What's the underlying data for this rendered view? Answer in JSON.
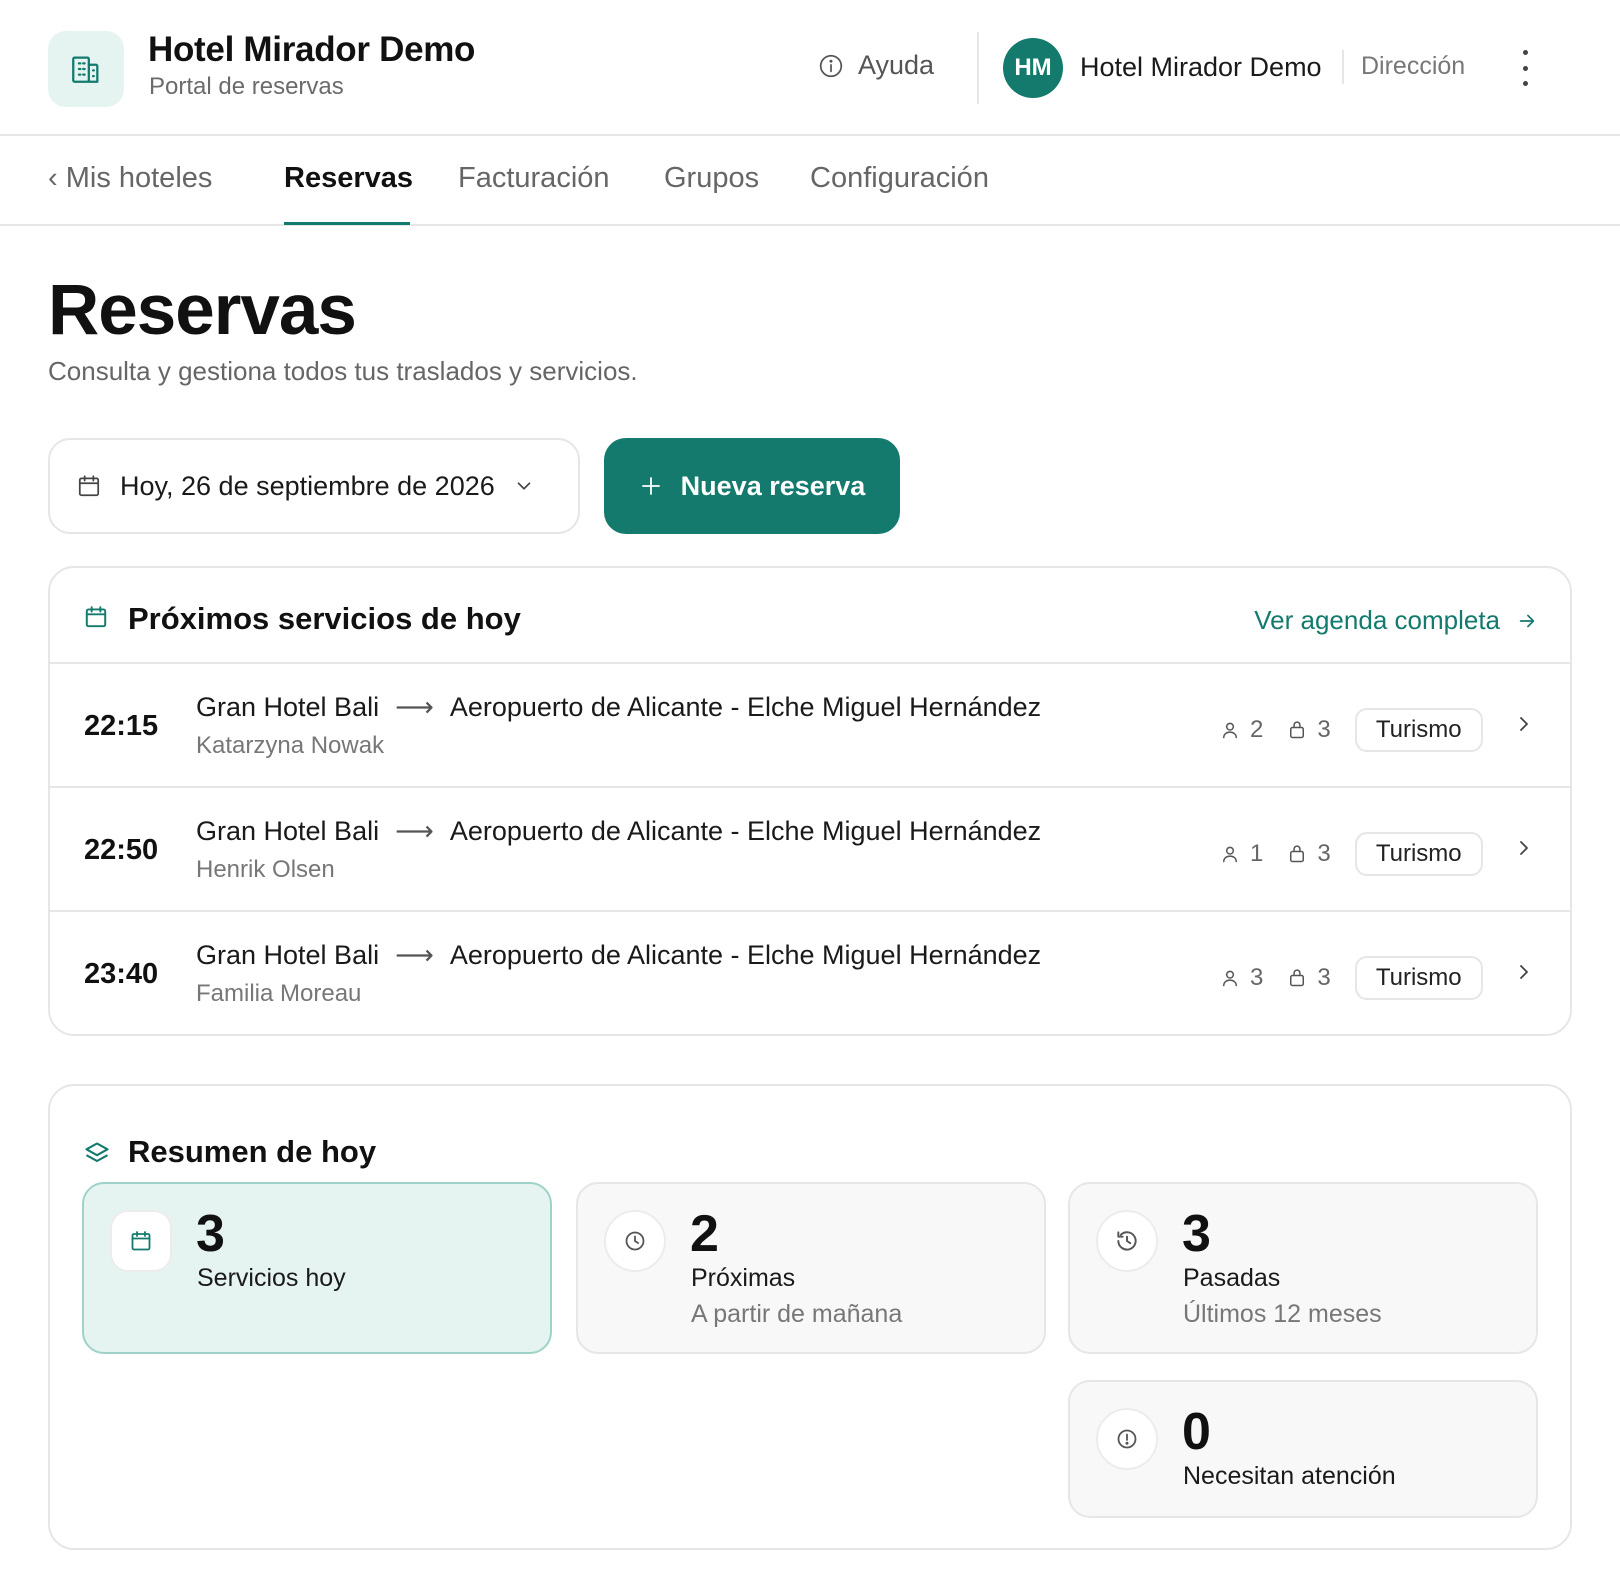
{
  "header": {
    "title": "Hotel Mirador Demo",
    "subtitle": "Portal de reservas",
    "help_label": "Ayuda",
    "avatar_initials": "HM",
    "user_name": "Hotel Mirador Demo",
    "user_role": "Dirección"
  },
  "nav": {
    "back_label": "‹ Mis hoteles",
    "tabs": [
      {
        "label": "Reservas",
        "active": true
      },
      {
        "label": "Facturación",
        "active": false
      },
      {
        "label": "Grupos",
        "active": false
      },
      {
        "label": "Configuración",
        "active": false
      }
    ]
  },
  "page": {
    "title": "Reservas",
    "subtitle": "Consulta y gestiona todos tus traslados y servicios."
  },
  "controls": {
    "date_label": "Hoy, 26 de septiembre de 2026",
    "new_button_label": "Nueva reserva"
  },
  "services": {
    "title": "Próximos servicios de hoy",
    "link_label": "Ver agenda completa",
    "rows": [
      {
        "time": "22:15",
        "from": "Gran Hotel Bali",
        "arrow": "⟶",
        "to": "Aeropuerto de Alicante - Elche Miguel Hernández",
        "guest": "Katarzyna Nowak",
        "passengers": "2",
        "luggage": "3",
        "tag": "Turismo"
      },
      {
        "time": "22:50",
        "from": "Gran Hotel Bali",
        "arrow": "⟶",
        "to": "Aeropuerto de Alicante - Elche Miguel Hernández",
        "guest": "Henrik Olsen",
        "passengers": "1",
        "luggage": "3",
        "tag": "Turismo"
      },
      {
        "time": "23:40",
        "from": "Gran Hotel Bali",
        "arrow": "⟶",
        "to": "Aeropuerto de Alicante - Elche Miguel Hernández",
        "guest": "Familia Moreau",
        "passengers": "3",
        "luggage": "3",
        "tag": "Turismo"
      }
    ]
  },
  "summary": {
    "title": "Resumen de hoy",
    "stats": [
      {
        "value": "3",
        "label": "Servicios hoy",
        "note": "",
        "icon": "calendar-icon"
      },
      {
        "value": "2",
        "label": "Próximas",
        "note": "A partir de mañana",
        "icon": "clock-icon"
      },
      {
        "value": "3",
        "label": "Pasadas",
        "note": "Últimos 12 meses",
        "icon": "history-icon"
      },
      {
        "value": "0",
        "label": "Necesitan atención",
        "note": "",
        "icon": "alert-icon"
      }
    ]
  },
  "colors": {
    "accent": "#137a6d",
    "accent_light": "#e6f4f1"
  }
}
